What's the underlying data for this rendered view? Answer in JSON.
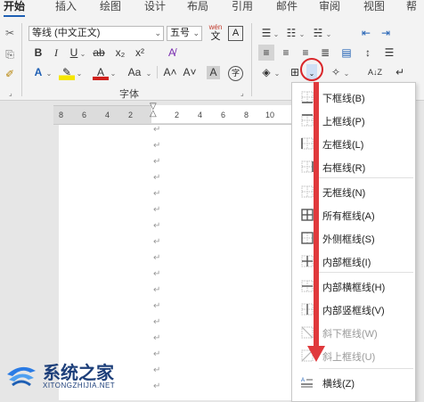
{
  "tabs": [
    "开始",
    "插入",
    "绘图",
    "设计",
    "布局",
    "引用",
    "邮件",
    "审阅",
    "视图",
    "帮"
  ],
  "font": {
    "name": "等线 (中文正文)",
    "size": "五号",
    "wen_top": "wén",
    "wen_bottom": "文",
    "char_box": "A"
  },
  "buttons": {
    "bold": "B",
    "italic": "I",
    "underline": "U",
    "strike": "ab",
    "subscript": "x₂",
    "superscript": "x²",
    "text_effects": "A",
    "highlight": "✎",
    "font_color": "A",
    "change_case": "Aa",
    "grow_font": "A˄",
    "shrink_font": "A˅",
    "char_shading": "A",
    "enclose": "字",
    "sort": "A↓Z",
    "show_marks": "↵"
  },
  "group_font_label": "字体",
  "ruler": [
    "8",
    "6",
    "4",
    "2",
    "2",
    "4",
    "6",
    "8",
    "10"
  ],
  "paragraph_mark": "↵",
  "menu": [
    {
      "label": "下框线(B)",
      "icon": "border-bottom-icon",
      "disabled": false
    },
    {
      "label": "上框线(P)",
      "icon": "border-top-icon",
      "disabled": false
    },
    {
      "label": "左框线(L)",
      "icon": "border-left-icon",
      "disabled": false
    },
    {
      "label": "右框线(R)",
      "icon": "border-right-icon",
      "disabled": false
    },
    {
      "label": "无框线(N)",
      "icon": "no-border-icon",
      "disabled": false
    },
    {
      "label": "所有框线(A)",
      "icon": "all-borders-icon",
      "disabled": false
    },
    {
      "label": "外侧框线(S)",
      "icon": "outside-borders-icon",
      "disabled": false
    },
    {
      "label": "内部框线(I)",
      "icon": "inside-borders-icon",
      "disabled": false
    },
    {
      "label": "内部横框线(H)",
      "icon": "inside-horizontal-border-icon",
      "disabled": false
    },
    {
      "label": "内部竖框线(V)",
      "icon": "inside-vertical-border-icon",
      "disabled": false
    },
    {
      "label": "斜下框线(W)",
      "icon": "diagonal-down-border-icon",
      "disabled": true
    },
    {
      "label": "斜上框线(U)",
      "icon": "diagonal-up-border-icon",
      "disabled": true
    },
    {
      "label": "横线(Z)",
      "icon": "horizontal-line-icon",
      "disabled": false
    }
  ],
  "watermark": {
    "title": "系统之家",
    "url": "XITONGZHIJIA.NET"
  },
  "colors": {
    "accent": "#1e5fb4",
    "annotation": "#e0393c"
  }
}
